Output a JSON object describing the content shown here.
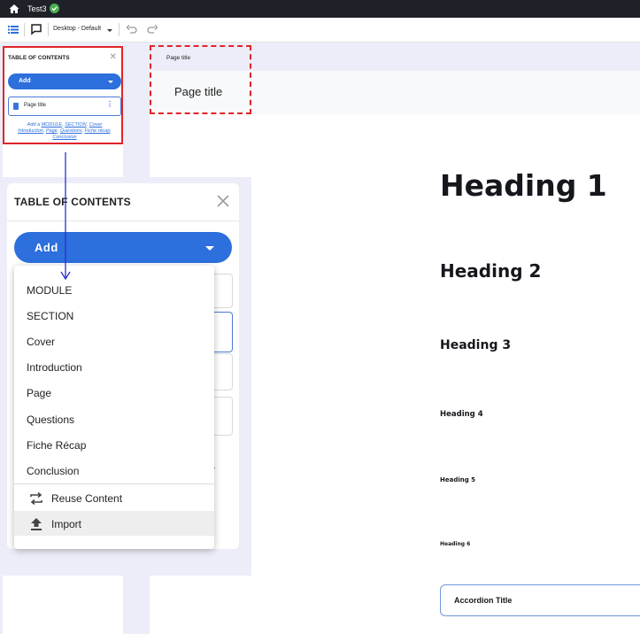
{
  "topbar": {
    "project_name": "Test3"
  },
  "toolbar": {
    "device_label": "Desktop - Default"
  },
  "toc_small": {
    "title": "TABLE OF CONTENTS",
    "add_label": "Add",
    "item_label": "Page title",
    "links_prefix": "Add a",
    "links": [
      "MODULE",
      "SECTION",
      "Cover",
      "Introduction",
      "Page",
      "Questions",
      "Fiche récap",
      "Conclusion"
    ]
  },
  "page": {
    "title_small": "Page title",
    "title_big": "Page title",
    "headings": [
      "Heading 1",
      "Heading 2",
      "Heading 3",
      "Heading 4",
      "Heading 5",
      "Heading 6"
    ],
    "accordion_title": "Accordion Title"
  },
  "toc_big": {
    "title": "TABLE OF CONTENTS",
    "add_label": "Add",
    "menu_items": [
      "MODULE",
      "SECTION",
      "Cover",
      "Introduction",
      "Page",
      "Questions",
      "Fiche Récap",
      "Conclusion"
    ],
    "reuse_label": "Reuse Content",
    "import_label": "Import"
  },
  "colors": {
    "accent": "#2d6fdc",
    "highlight": "#e0242a",
    "success": "#4caf50"
  }
}
